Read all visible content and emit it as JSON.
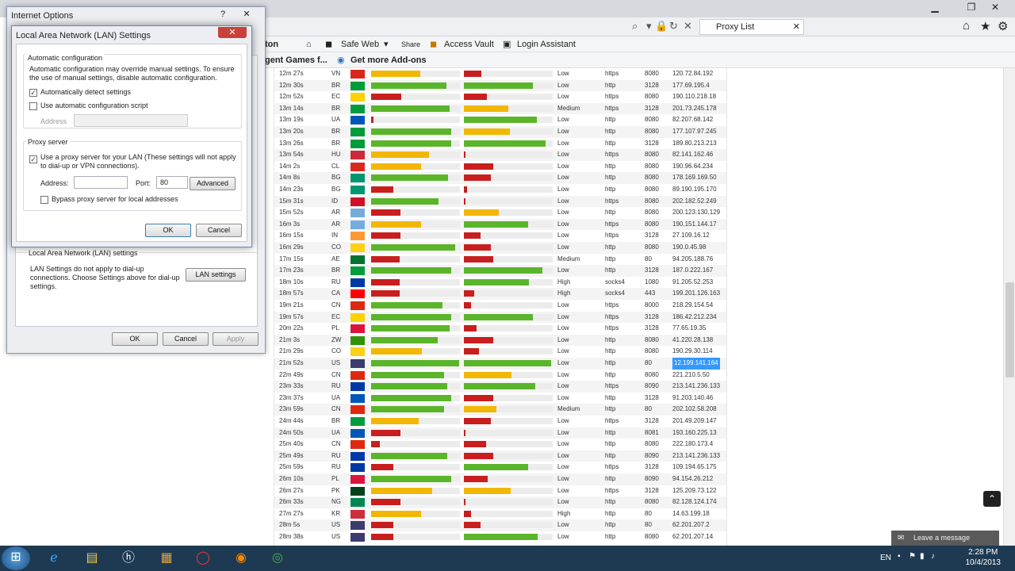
{
  "browser": {
    "tab_title": "Proxy List",
    "cmd": {
      "toolbar_fragment": "ton",
      "safe_web": "Safe Web",
      "share": "Share",
      "access_vault": "Access Vault",
      "login_assistant": "Login Assistant"
    },
    "fav": {
      "games": "gent Games f...",
      "addons": "Get more Add-ons"
    }
  },
  "proxy_rows": [
    {
      "time": "12m 27s",
      "cc": "VN",
      "flag": "#da251d",
      "b1": 0.55,
      "c1": "#f2b705",
      "b2": 0.2,
      "c2": "#c81e1e",
      "anon": "Low",
      "proto": "https",
      "port": "8080",
      "ip": "120.72.84.192"
    },
    {
      "time": "12m 30s",
      "cc": "BR",
      "flag": "#009c3b",
      "b1": 0.85,
      "c1": "#5ab52a",
      "b2": 0.78,
      "c2": "#5ab52a",
      "anon": "Low",
      "proto": "http",
      "port": "3128",
      "ip": "177.69.195.4"
    },
    {
      "time": "12m 52s",
      "cc": "EC",
      "flag": "#ffd100",
      "b1": 0.34,
      "c1": "#c81e1e",
      "b2": 0.26,
      "c2": "#c81e1e",
      "anon": "Low",
      "proto": "https",
      "port": "8080",
      "ip": "190.110.218.18"
    },
    {
      "time": "13m 14s",
      "cc": "BR",
      "flag": "#009c3b",
      "b1": 0.88,
      "c1": "#5ab52a",
      "b2": 0.5,
      "c2": "#f2b705",
      "anon": "Medium",
      "proto": "https",
      "port": "3128",
      "ip": "201.73.245.178"
    },
    {
      "time": "13m 19s",
      "cc": "UA",
      "flag": "#0057b7",
      "b1": 0.03,
      "c1": "#c81e1e",
      "b2": 0.82,
      "c2": "#5ab52a",
      "anon": "Low",
      "proto": "http",
      "port": "8080",
      "ip": "82.207.68.142"
    },
    {
      "time": "13m 20s",
      "cc": "BR",
      "flag": "#009c3b",
      "b1": 0.9,
      "c1": "#5ab52a",
      "b2": 0.52,
      "c2": "#f2b705",
      "anon": "Low",
      "proto": "http",
      "port": "8080",
      "ip": "177.107.97.245"
    },
    {
      "time": "13m 26s",
      "cc": "BR",
      "flag": "#009c3b",
      "b1": 0.9,
      "c1": "#5ab52a",
      "b2": 0.92,
      "c2": "#5ab52a",
      "anon": "Low",
      "proto": "http",
      "port": "3128",
      "ip": "189.80.213.213"
    },
    {
      "time": "13m 54s",
      "cc": "HU",
      "flag": "#ce2939",
      "b1": 0.65,
      "c1": "#f2b705",
      "b2": 0.02,
      "c2": "#c81e1e",
      "anon": "Low",
      "proto": "https",
      "port": "8080",
      "ip": "82.141.162.46"
    },
    {
      "time": "14m 2s",
      "cc": "CL",
      "flag": "#d52b1e",
      "b1": 0.56,
      "c1": "#f2b705",
      "b2": 0.33,
      "c2": "#c81e1e",
      "anon": "Low",
      "proto": "http",
      "port": "8080",
      "ip": "190.96.64.234"
    },
    {
      "time": "14m 8s",
      "cc": "BG",
      "flag": "#00966e",
      "b1": 0.87,
      "c1": "#5ab52a",
      "b2": 0.3,
      "c2": "#c81e1e",
      "anon": "Low",
      "proto": "http",
      "port": "8080",
      "ip": "178.169.169.50"
    },
    {
      "time": "14m 23s",
      "cc": "BG",
      "flag": "#00966e",
      "b1": 0.25,
      "c1": "#c81e1e",
      "b2": 0.04,
      "c2": "#c81e1e",
      "anon": "Low",
      "proto": "http",
      "port": "8080",
      "ip": "89.190.195.170"
    },
    {
      "time": "15m 31s",
      "cc": "ID",
      "flag": "#ce1126",
      "b1": 0.76,
      "c1": "#5ab52a",
      "b2": 0.02,
      "c2": "#c81e1e",
      "anon": "Low",
      "proto": "https",
      "port": "8080",
      "ip": "202.182.52.249"
    },
    {
      "time": "15m 52s",
      "cc": "AR",
      "flag": "#74acdf",
      "b1": 0.33,
      "c1": "#c81e1e",
      "b2": 0.39,
      "c2": "#f2b705",
      "anon": "Low",
      "proto": "http",
      "port": "8080",
      "ip": "200.123.130.129"
    },
    {
      "time": "16m 3s",
      "cc": "AR",
      "flag": "#74acdf",
      "b1": 0.56,
      "c1": "#f2b705",
      "b2": 0.72,
      "c2": "#5ab52a",
      "anon": "Low",
      "proto": "https",
      "port": "8080",
      "ip": "190.151.144.17"
    },
    {
      "time": "16m 15s",
      "cc": "IN",
      "flag": "#ff9933",
      "b1": 0.33,
      "c1": "#c81e1e",
      "b2": 0.19,
      "c2": "#c81e1e",
      "anon": "Low",
      "proto": "https",
      "port": "3128",
      "ip": "27.109.16.12"
    },
    {
      "time": "16m 29s",
      "cc": "CO",
      "flag": "#fcd116",
      "b1": 0.95,
      "c1": "#5ab52a",
      "b2": 0.3,
      "c2": "#c81e1e",
      "anon": "Low",
      "proto": "http",
      "port": "8080",
      "ip": "190.0.45.98"
    },
    {
      "time": "17m 15s",
      "cc": "AE",
      "flag": "#00732f",
      "b1": 0.32,
      "c1": "#c81e1e",
      "b2": 0.33,
      "c2": "#c81e1e",
      "anon": "Medium",
      "proto": "http",
      "port": "80",
      "ip": "94.205.188.76"
    },
    {
      "time": "17m 23s",
      "cc": "BR",
      "flag": "#009c3b",
      "b1": 0.9,
      "c1": "#5ab52a",
      "b2": 0.88,
      "c2": "#5ab52a",
      "anon": "Low",
      "proto": "http",
      "port": "3128",
      "ip": "187.0.222.167"
    },
    {
      "time": "18m 10s",
      "cc": "RU",
      "flag": "#0039a6",
      "b1": 0.32,
      "c1": "#c81e1e",
      "b2": 0.73,
      "c2": "#5ab52a",
      "anon": "High",
      "proto": "socks4",
      "port": "1080",
      "ip": "91.205.52.253"
    },
    {
      "time": "18m 57s",
      "cc": "CA",
      "flag": "#ff0000",
      "b1": 0.32,
      "c1": "#c81e1e",
      "b2": 0.12,
      "c2": "#c81e1e",
      "anon": "High",
      "proto": "socks4",
      "port": "443",
      "ip": "199.201.126.163"
    },
    {
      "time": "19m 21s",
      "cc": "CN",
      "flag": "#de2910",
      "b1": 0.8,
      "c1": "#5ab52a",
      "b2": 0.08,
      "c2": "#c81e1e",
      "anon": "Low",
      "proto": "https",
      "port": "8000",
      "ip": "218.29.154.54"
    },
    {
      "time": "19m 57s",
      "cc": "EC",
      "flag": "#ffd100",
      "b1": 0.9,
      "c1": "#5ab52a",
      "b2": 0.78,
      "c2": "#5ab52a",
      "anon": "Low",
      "proto": "https",
      "port": "3128",
      "ip": "186.42.212.234"
    },
    {
      "time": "20m 22s",
      "cc": "PL",
      "flag": "#dc143c",
      "b1": 0.88,
      "c1": "#5ab52a",
      "b2": 0.14,
      "c2": "#c81e1e",
      "anon": "Low",
      "proto": "https",
      "port": "3128",
      "ip": "77.65.19.35"
    },
    {
      "time": "21m 3s",
      "cc": "ZW",
      "flag": "#319208",
      "b1": 0.75,
      "c1": "#5ab52a",
      "b2": 0.33,
      "c2": "#c81e1e",
      "anon": "Low",
      "proto": "http",
      "port": "8080",
      "ip": "41.220.28.138"
    },
    {
      "time": "21m 29s",
      "cc": "CO",
      "flag": "#fcd116",
      "b1": 0.57,
      "c1": "#f2b705",
      "b2": 0.17,
      "c2": "#c81e1e",
      "anon": "Low",
      "proto": "http",
      "port": "8080",
      "ip": "190.29.30.114"
    },
    {
      "time": "21m 52s",
      "cc": "US",
      "flag": "#3c3b6e",
      "b1": 0.99,
      "c1": "#5ab52a",
      "b2": 0.98,
      "c2": "#5ab52a",
      "anon": "Low",
      "proto": "http",
      "port": "80",
      "ip": "12.199.141.164",
      "selected": true
    },
    {
      "time": "22m 49s",
      "cc": "CN",
      "flag": "#de2910",
      "b1": 0.82,
      "c1": "#5ab52a",
      "b2": 0.54,
      "c2": "#f2b705",
      "anon": "Low",
      "proto": "http",
      "port": "8080",
      "ip": "221.210.5.50"
    },
    {
      "time": "23m 33s",
      "cc": "RU",
      "flag": "#0039a6",
      "b1": 0.86,
      "c1": "#5ab52a",
      "b2": 0.8,
      "c2": "#5ab52a",
      "anon": "Low",
      "proto": "https",
      "port": "8090",
      "ip": "213.141.236.133"
    },
    {
      "time": "23m 37s",
      "cc": "UA",
      "flag": "#0057b7",
      "b1": 0.9,
      "c1": "#5ab52a",
      "b2": 0.33,
      "c2": "#c81e1e",
      "anon": "Low",
      "proto": "http",
      "port": "3128",
      "ip": "91.203.140.46"
    },
    {
      "time": "23m 59s",
      "cc": "CN",
      "flag": "#de2910",
      "b1": 0.82,
      "c1": "#5ab52a",
      "b2": 0.37,
      "c2": "#f2b705",
      "anon": "Medium",
      "proto": "http",
      "port": "80",
      "ip": "202.102.58.208"
    },
    {
      "time": "24m 44s",
      "cc": "BR",
      "flag": "#009c3b",
      "b1": 0.54,
      "c1": "#f2b705",
      "b2": 0.3,
      "c2": "#c81e1e",
      "anon": "Low",
      "proto": "https",
      "port": "3128",
      "ip": "201.49.209.147"
    },
    {
      "time": "24m 50s",
      "cc": "UA",
      "flag": "#0057b7",
      "b1": 0.33,
      "c1": "#c81e1e",
      "b2": 0.02,
      "c2": "#c81e1e",
      "anon": "Low",
      "proto": "http",
      "port": "8081",
      "ip": "193.160.225.13"
    },
    {
      "time": "25m 40s",
      "cc": "CN",
      "flag": "#de2910",
      "b1": 0.1,
      "c1": "#c81e1e",
      "b2": 0.25,
      "c2": "#c81e1e",
      "anon": "Low",
      "proto": "http",
      "port": "8080",
      "ip": "222.180.173.4"
    },
    {
      "time": "25m 49s",
      "cc": "RU",
      "flag": "#0039a6",
      "b1": 0.86,
      "c1": "#5ab52a",
      "b2": 0.33,
      "c2": "#c81e1e",
      "anon": "Low",
      "proto": "http",
      "port": "8090",
      "ip": "213.141.236.133"
    },
    {
      "time": "25m 59s",
      "cc": "RU",
      "flag": "#0039a6",
      "b1": 0.25,
      "c1": "#c81e1e",
      "b2": 0.72,
      "c2": "#5ab52a",
      "anon": "Low",
      "proto": "https",
      "port": "3128",
      "ip": "109.194.65.175"
    },
    {
      "time": "26m 10s",
      "cc": "PL",
      "flag": "#dc143c",
      "b1": 0.9,
      "c1": "#5ab52a",
      "b2": 0.27,
      "c2": "#c81e1e",
      "anon": "Low",
      "proto": "http",
      "port": "8090",
      "ip": "94.154.26.212"
    },
    {
      "time": "26m 27s",
      "cc": "PK",
      "flag": "#01411c",
      "b1": 0.69,
      "c1": "#f2b705",
      "b2": 0.53,
      "c2": "#f2b705",
      "anon": "Low",
      "proto": "https",
      "port": "3128",
      "ip": "125.209.73.122"
    },
    {
      "time": "26m 33s",
      "cc": "NG",
      "flag": "#008751",
      "b1": 0.33,
      "c1": "#c81e1e",
      "b2": 0.02,
      "c2": "#c81e1e",
      "anon": "Low",
      "proto": "http",
      "port": "8080",
      "ip": "82.128.124.174"
    },
    {
      "time": "27m 27s",
      "cc": "KR",
      "flag": "#cd2e3a",
      "b1": 0.56,
      "c1": "#f2b705",
      "b2": 0.08,
      "c2": "#c81e1e",
      "anon": "High",
      "proto": "http",
      "port": "80",
      "ip": "14.63.199.18"
    },
    {
      "time": "28m 5s",
      "cc": "US",
      "flag": "#3c3b6e",
      "b1": 0.25,
      "c1": "#c81e1e",
      "b2": 0.19,
      "c2": "#c81e1e",
      "anon": "Low",
      "proto": "http",
      "port": "80",
      "ip": "62.201.207.2"
    },
    {
      "time": "28m 38s",
      "cc": "US",
      "flag": "#3c3b6e",
      "b1": 0.25,
      "c1": "#c81e1e",
      "b2": 0.83,
      "c2": "#5ab52a",
      "anon": "Low",
      "proto": "http",
      "port": "8080",
      "ip": "62.201.207.14"
    }
  ],
  "inet": {
    "title": "Internet Options",
    "lan_group_label": "Local Area Network (LAN) settings",
    "lan_desc": "LAN Settings do not apply to dial-up connections. Choose Settings above for dial-up settings.",
    "lan_settings_btn": "LAN settings",
    "ok": "OK",
    "cancel": "Cancel",
    "apply": "Apply"
  },
  "lan": {
    "title": "Local Area Network (LAN) Settings",
    "auto_group": "Automatic configuration",
    "auto_desc": "Automatic configuration may override manual settings.  To ensure the use of manual settings, disable automatic configuration.",
    "auto_detect": "Automatically detect settings",
    "auto_script": "Use automatic configuration script",
    "address_label": "Address",
    "proxy_group": "Proxy server",
    "use_proxy": "Use a proxy server for your LAN (These settings will not apply to dial-up or VPN connections).",
    "proxy_address_label": "Address:",
    "port_label": "Port:",
    "port_value": "80",
    "advanced": "Advanced",
    "bypass": "Bypass proxy server for local addresses",
    "ok": "OK",
    "cancel": "Cancel"
  },
  "chat": {
    "leave_message": "Leave a message"
  },
  "tray": {
    "lang": "EN",
    "time": "2:28 PM",
    "date": "10/4/2013"
  }
}
